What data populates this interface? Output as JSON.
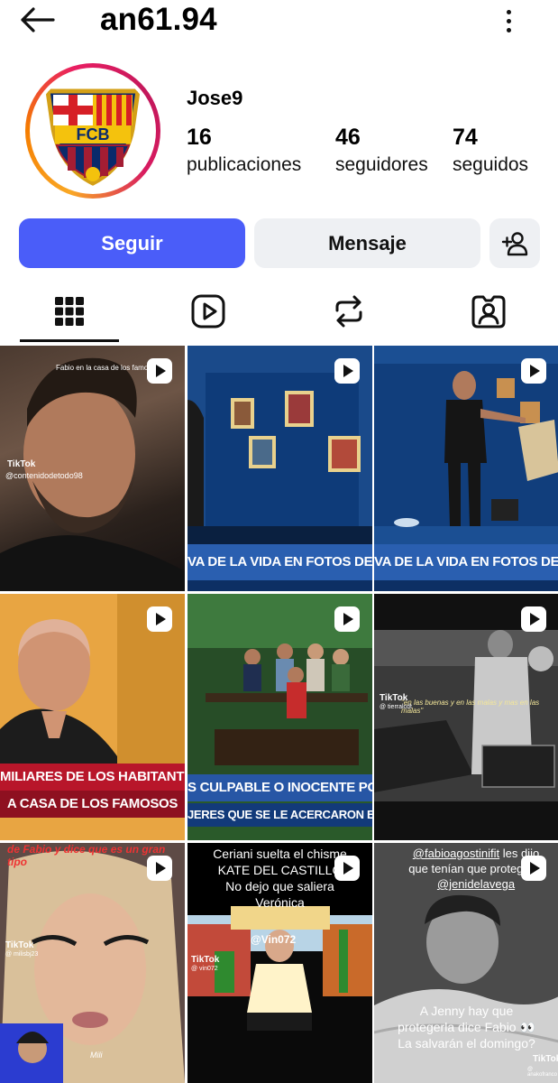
{
  "header": {
    "handle": "an61.94"
  },
  "profile": {
    "name": "Jose9",
    "avatar_text": "FCB",
    "stats": [
      {
        "value": "16",
        "label": "publicaciones"
      },
      {
        "value": "46",
        "label": "seguidores"
      },
      {
        "value": "74",
        "label": "seguidos"
      }
    ]
  },
  "actions": {
    "follow": "Seguir",
    "message": "Mensaje"
  },
  "tabs": [
    "grid-icon",
    "reels-icon",
    "reposts-icon",
    "tagged-icon"
  ],
  "posts": [
    {
      "top_caption": "Fabio en la casa de los famosos",
      "tiktok": "TikTok",
      "tiktok_user": "@contenidodetodo98"
    },
    {
      "caption": "VA DE LA VIDA EN FOTOS DE FABIO"
    },
    {
      "caption": "VA DE LA VIDA EN FOTOS DE FABIO"
    },
    {
      "caption1": "MILIARES DE LOS HABITANTES",
      "caption2": "A CASA DE LOS FAMOSOS"
    },
    {
      "caption1": "S CULPABLE O INOCENTE POR LA SALI",
      "caption2": "JERES QUE SE LE ACERCARON EN LA CA"
    },
    {
      "quote": "\"en las buenas y en las malas y mas en las malas\"",
      "tiktok": "TikTok",
      "tiktok_user": "@ tierralcdt"
    },
    {
      "top_caption": "de Fabio y dice que es un gran tipo",
      "tiktok": "TikTok",
      "tiktok_user": "@ milisbj23",
      "name_tag": "Mili"
    },
    {
      "line1": "Ceriani suelta el chisme",
      "line2": "KATE DEL CASTILLO",
      "line3": "No dejo que saliera",
      "line4": "Verónica",
      "tiktok": "TikTok",
      "tiktok_user": "@ vin072",
      "watermark": "@Vin072"
    },
    {
      "line1_link": "@fabioagostinifit",
      "line1_rest": " les dijo",
      "line2": "que tenían que proteger a",
      "line3_link": "@jenidelavega",
      "bottom1": "A Jenny hay que",
      "bottom2": "protegerla dice Fabio 👀",
      "bottom3": "La salvarán el domingo?",
      "tiktok": "TikTok",
      "tiktok_user": "@ anakofranco"
    }
  ]
}
